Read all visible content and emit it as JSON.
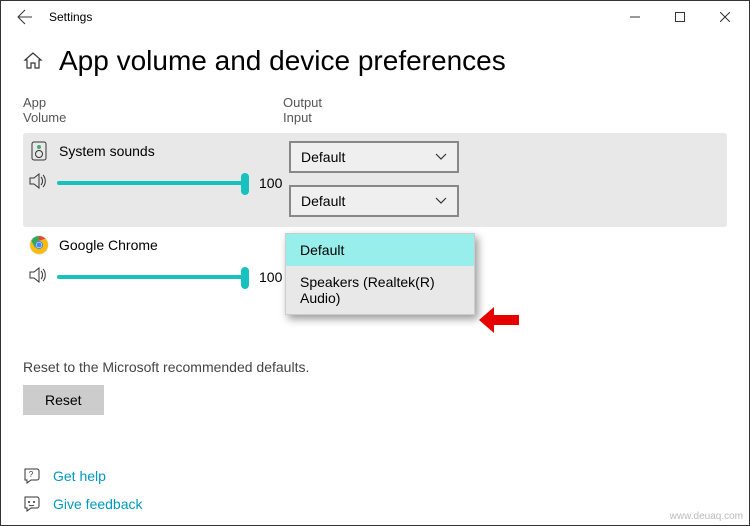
{
  "titlebar": {
    "title": "Settings"
  },
  "header": {
    "page_title": "App volume and device preferences"
  },
  "columns": {
    "left_line1": "App",
    "left_line2": "Volume",
    "right_line1": "Output",
    "right_line2": "Input"
  },
  "apps": {
    "system": {
      "name": "System sounds",
      "volume": "100",
      "output": "Default",
      "input": "Default"
    },
    "chrome": {
      "name": "Google Chrome",
      "volume": "100"
    }
  },
  "dropdown": {
    "option1": "Default",
    "option2": "Speakers (Realtek(R) Audio)"
  },
  "reset": {
    "text": "Reset to the Microsoft recommended defaults.",
    "button": "Reset"
  },
  "footer": {
    "help": "Get help",
    "feedback": "Give feedback"
  },
  "watermark": "www.deuaq.com"
}
